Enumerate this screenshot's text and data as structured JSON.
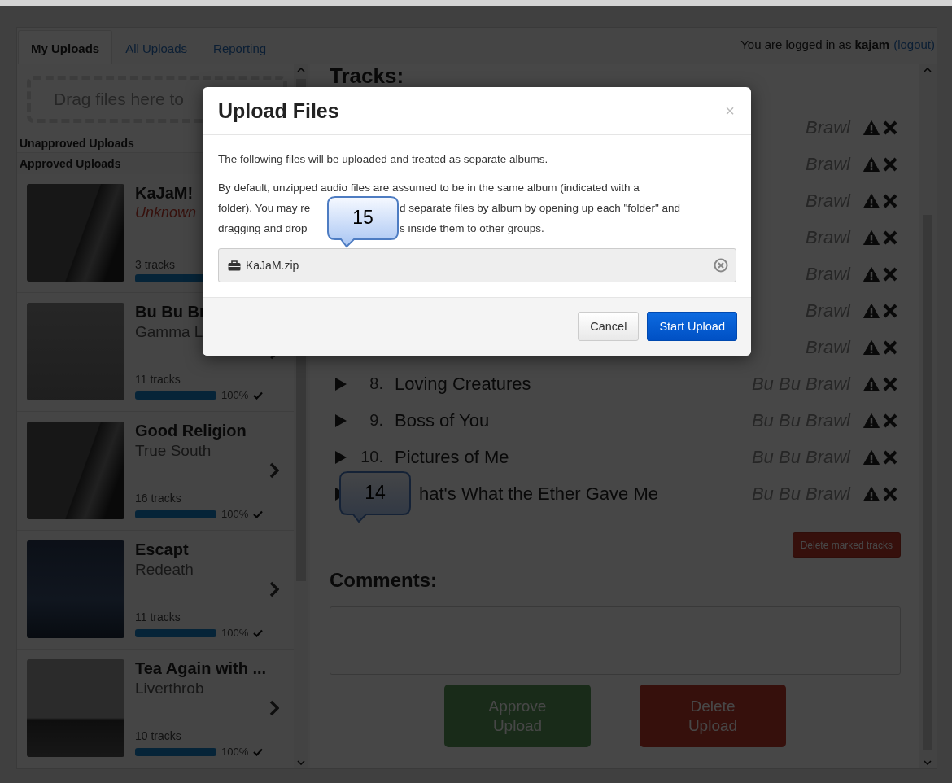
{
  "tabs": [
    {
      "label": "My Uploads",
      "selected": true
    },
    {
      "label": "All Uploads",
      "selected": false
    },
    {
      "label": "Reporting",
      "selected": false
    }
  ],
  "login": {
    "prefix": "You are logged in as",
    "user": "kajam",
    "link": "(logout)"
  },
  "sidebar": {
    "drop_zone": "Drag files here to",
    "sections": [
      "Unapproved Uploads",
      "Approved Uploads"
    ],
    "albums": [
      {
        "title": "KaJaM!",
        "artist": "Unknown",
        "unknown": true,
        "tracks": "3 tracks",
        "level": 1
      },
      {
        "title": "Bu Bu Br",
        "artist": "Gamma L",
        "unknown": false,
        "tracks": "11 tracks",
        "level": 1,
        "percent": "100%",
        "complete": true
      },
      {
        "title": "Good Religion",
        "artist": "True South",
        "unknown": false,
        "tracks": "16 tracks",
        "level": 1,
        "percent": "100%",
        "complete": true
      },
      {
        "title": "Escapt",
        "artist": "Redeath",
        "unknown": false,
        "tracks": "11 tracks",
        "level": 1,
        "percent": "100%",
        "complete": true
      },
      {
        "title": "Tea Again with ...",
        "artist": "Liverthrob",
        "unknown": false,
        "tracks": "10 tracks",
        "level": 1,
        "percent": "100%",
        "complete": true
      }
    ]
  },
  "tracks": {
    "heading": "Tracks:",
    "rows": [
      {
        "artist": "Brawl"
      },
      {
        "artist": "Brawl"
      },
      {
        "artist": "Brawl"
      },
      {
        "artist": "Brawl"
      },
      {
        "artist": "Brawl"
      },
      {
        "artist": "Brawl"
      },
      {
        "artist": "Brawl"
      },
      {
        "number": "8.",
        "title": "Loving Creatures",
        "artist": "Bu Bu Brawl"
      },
      {
        "number": "9.",
        "title": "Boss of You",
        "artist": "Bu Bu Brawl"
      },
      {
        "number": "10.",
        "title": "Pictures of Me",
        "artist": "Bu Bu Brawl"
      },
      {
        "title": "hat's What the Ether Gave Me",
        "artist": "Bu Bu Brawl",
        "callout": "14"
      }
    ],
    "delete_button": "Delete marked tracks"
  },
  "comments": {
    "heading": "Comments:"
  },
  "actions": [
    {
      "label": "Approve Upload",
      "kind": "approve"
    },
    {
      "label": "Delete Upload",
      "kind": "delete"
    }
  ],
  "modal": {
    "title": "Upload Files",
    "close": "×",
    "intro": "The following files will be uploaded and treated as separate albums.",
    "lines": [
      [
        "By default, unzipped audio files are assumed to be in the same album (indicated with a"
      ],
      [
        "folder). You may re",
        "d separate files by album by opening up each \"folder\" and"
      ],
      [
        "dragging and drop",
        "s inside them to other groups."
      ]
    ],
    "callout": "15",
    "file": "KaJaM.zip",
    "buttons": [
      {
        "label": "Cancel",
        "kind": "default"
      },
      {
        "label": "Start Upload",
        "kind": "primary"
      }
    ]
  }
}
